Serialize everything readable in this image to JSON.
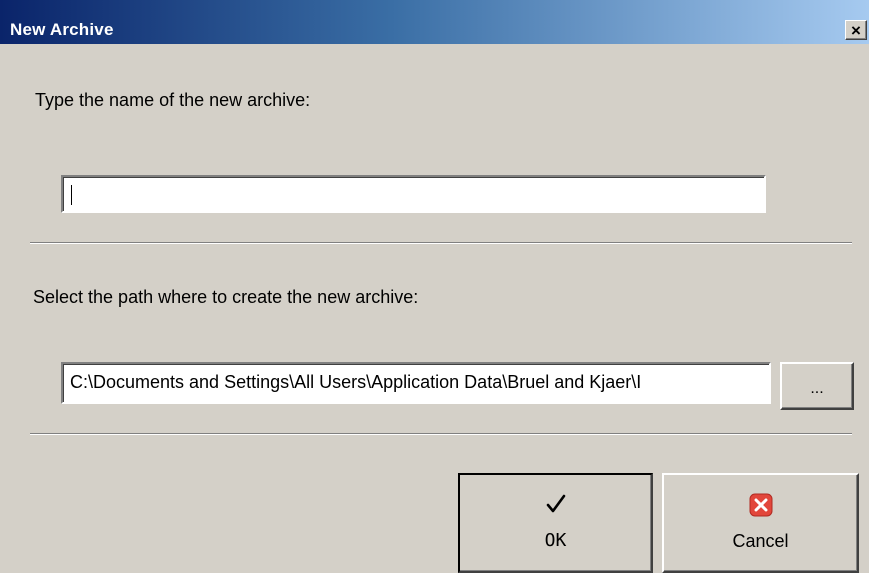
{
  "window": {
    "title": "New Archive",
    "close_glyph": "×"
  },
  "name_section": {
    "label": "Type the name of the new archive:",
    "value": ""
  },
  "path_section": {
    "label": "Select the path where to create the new archive:",
    "value": "C:\\Documents and Settings\\All Users\\Application Data\\Bruel and Kjaer\\I",
    "browse_label": "..."
  },
  "buttons": {
    "ok_label": "OK",
    "ok_icon": "checkmark-icon",
    "cancel_label": "Cancel",
    "cancel_icon": "cancel-x-icon"
  },
  "colors": {
    "titlebar_start": "#0a246a",
    "titlebar_end": "#a6caf0",
    "dialog_face": "#d4d0c8",
    "cancel_icon_red": "#e2463b"
  }
}
